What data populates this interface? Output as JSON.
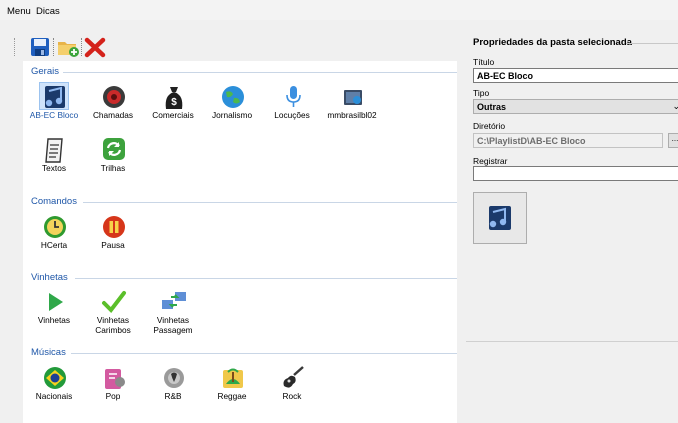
{
  "menu": {
    "items": [
      "Menu",
      "Dicas"
    ]
  },
  "toolbar": {
    "buttons": [
      {
        "name": "save-icon",
        "color": "#1f5fbf"
      },
      {
        "name": "add-folder-icon",
        "color": "#e8b44a"
      },
      {
        "name": "delete-icon",
        "color": "#d4221b"
      }
    ]
  },
  "groups": [
    {
      "title": "Gerais",
      "items": [
        {
          "label": "AB-EC Bloco",
          "icon": "audio-folder-icon",
          "selected": true
        },
        {
          "label": "Chamadas",
          "icon": "speaker-icon"
        },
        {
          "label": "Comerciais",
          "icon": "money-bag-icon"
        },
        {
          "label": "Jornalismo",
          "icon": "globe-icon"
        },
        {
          "label": "Locuções",
          "icon": "microphone-icon"
        },
        {
          "label": "mmbrasilbl02",
          "icon": "media-folder-icon"
        },
        {
          "label": "Textos",
          "icon": "document-icon"
        },
        {
          "label": "Trilhas",
          "icon": "refresh-icon"
        }
      ]
    },
    {
      "title": "Comandos",
      "items": [
        {
          "label": "HCerta",
          "icon": "clock-icon"
        },
        {
          "label": "Pausa",
          "icon": "pause-icon"
        }
      ]
    },
    {
      "title": "Vinhetas",
      "items": [
        {
          "label": "Vinhetas",
          "icon": "play-icon"
        },
        {
          "label": "Vinhetas Carimbos",
          "icon": "checkmark-icon"
        },
        {
          "label": "Vinhetas Passagem",
          "icon": "network-transfer-icon"
        }
      ]
    },
    {
      "title": "Músicas",
      "items": [
        {
          "label": "Nacionais",
          "icon": "brazil-flag-icon"
        },
        {
          "label": "Pop",
          "icon": "pop-music-icon"
        },
        {
          "label": "R&B",
          "icon": "rnb-disc-icon"
        },
        {
          "label": "Reggae",
          "icon": "reggae-icon"
        },
        {
          "label": "Rock",
          "icon": "guitar-icon"
        }
      ]
    }
  ],
  "properties": {
    "title": "Propriedades da pasta selecionada",
    "titulo_label": "Título",
    "titulo_value": "AB-EC Bloco",
    "tipo_label": "Tipo",
    "tipo_value": "Outras",
    "diretorio_label": "Diretório",
    "diretorio_value": "C:\\PlaylistD\\AB-EC Bloco",
    "browse_label": "...",
    "registrar_label": "Registrar",
    "registrar_value": "",
    "icon": "audio-folder-icon"
  },
  "colors": {
    "accent": "#1f57a8",
    "selection": "#cfe3fb",
    "group_line": "#c9d6e6"
  }
}
